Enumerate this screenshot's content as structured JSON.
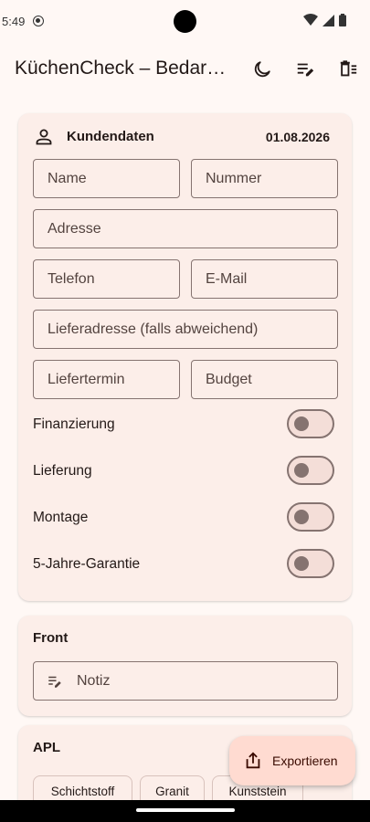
{
  "status_bar": {
    "time": "5:49",
    "icons": [
      "wifi-icon",
      "signal-icon",
      "battery-icon"
    ]
  },
  "app_bar": {
    "title": "KüchenCheck – Bedarfsanalyse",
    "actions": [
      "dark-mode-icon",
      "edit-list-icon",
      "clear-all-icon"
    ]
  },
  "customer_card": {
    "title": "Kundendaten",
    "date": "01.08.2026",
    "fields": {
      "name": "Name",
      "number": "Nummer",
      "address": "Adresse",
      "phone": "Telefon",
      "email": "E-Mail",
      "delivery_address": "Lieferadresse (falls abweichend)",
      "delivery_date": "Liefertermin",
      "budget": "Budget"
    },
    "switches": [
      {
        "label": "Finanzierung",
        "on": false
      },
      {
        "label": "Lieferung",
        "on": false
      },
      {
        "label": "Montage",
        "on": false
      },
      {
        "label": "5-Jahre-Garantie",
        "on": false
      }
    ]
  },
  "front_card": {
    "title": "Front",
    "note_label": "Notiz"
  },
  "apl_card": {
    "title": "APL",
    "chips": [
      "Schichtstoff",
      "Granit",
      "Kunststein"
    ]
  },
  "fab": {
    "label": "Exportieren"
  },
  "colors": {
    "background": "#FFF8F5",
    "card": "#FCEEE9",
    "outline": "#857370",
    "fab": "#FFDBD1"
  }
}
